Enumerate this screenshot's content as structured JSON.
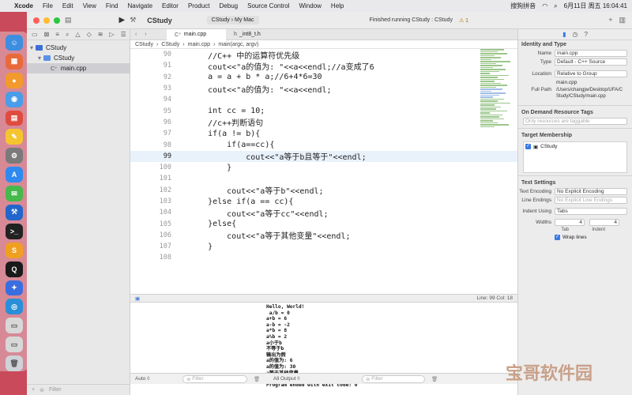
{
  "menubar": {
    "apple": "",
    "app": "Xcode",
    "items": [
      "File",
      "Edit",
      "View",
      "Find",
      "Navigate",
      "Editor",
      "Product",
      "Debug",
      "Source Control",
      "Window",
      "Help"
    ],
    "input_method": "搜狗拼音",
    "datetime": "6月11日 周五 16:04:41"
  },
  "toolbar": {
    "project": "CStudy",
    "scheme_target": "CStudy",
    "scheme_device": "My Mac",
    "status": "Finished running CStudy : CStudy",
    "warning": "⚠ 1"
  },
  "navigator": {
    "items": [
      {
        "label": "CStudy",
        "type": "project"
      },
      {
        "label": "CStudy",
        "type": "folder"
      },
      {
        "label": "main.cpp",
        "type": "file"
      }
    ],
    "filter_placeholder": "Filter"
  },
  "editor": {
    "tabs": [
      "main.cpp",
      "_int8_t.h"
    ],
    "jumpbar": [
      "CStudy",
      "CStudy",
      "main.cpp",
      "main(argc, argv)"
    ],
    "current_line": 99,
    "lines": [
      {
        "n": "90",
        "t": "    //C++ 中的运算符优先级"
      },
      {
        "n": "91",
        "t": "    cout<<\"a的值为: \"<<a<<endl;//a变成了6"
      },
      {
        "n": "92",
        "t": "    a = a + b * a;//6+4*6=30"
      },
      {
        "n": "93",
        "t": "    cout<<\"a的值为: \"<<a<<endl;"
      },
      {
        "n": "94",
        "t": ""
      },
      {
        "n": "95",
        "t": "    int cc = 10;"
      },
      {
        "n": "96",
        "t": "    //c++判断语句"
      },
      {
        "n": "97",
        "t": "    if(a != b){"
      },
      {
        "n": "98",
        "t": "        if(a==cc){"
      },
      {
        "n": "99",
        "t": "            cout<<\"a等于b且等于\"<<endl;"
      },
      {
        "n": "100",
        "t": "        }"
      },
      {
        "n": "101",
        "t": ""
      },
      {
        "n": "102",
        "t": "        cout<<\"a等于b\"<<endl;"
      },
      {
        "n": "103",
        "t": "    }else if(a == cc){"
      },
      {
        "n": "104",
        "t": "        cout<<\"a等于cc\"<<endl;"
      },
      {
        "n": "105",
        "t": "    }else{"
      },
      {
        "n": "106",
        "t": "        cout<<\"a等于其他变量\"<<endl;"
      },
      {
        "n": "107",
        "t": "    }"
      },
      {
        "n": "108",
        "t": ""
      }
    ]
  },
  "debugbar": {
    "position": "Line: 99  Col: 18"
  },
  "console": {
    "lines": [
      "Hello, World!",
      " a/b = 0",
      "a+b = 6",
      "a-b = -2",
      "a*b = 8",
      "a%b = 2",
      "a小于b",
      "不等于b",
      "输出为假",
      "a的值为: 6",
      "a的值为: 30",
      "a等于其他变量",
      "0000000",
      "Program ended with exit code: 0"
    ],
    "mode": "Auto ◊",
    "filter_placeholder": "Filter",
    "output_selector": "All Output ◊",
    "filter2_placeholder": "Filter"
  },
  "inspector": {
    "identity_title": "Identity and Type",
    "name_label": "Name",
    "name_value": "main.cpp",
    "type_label": "Type",
    "type_value": "Default - C++ Source",
    "location_label": "Location",
    "location_value": "Relative to Group",
    "location_file": "main.cpp",
    "fullpath_label": "Full Path",
    "fullpath_value": "/Users/changjw/Desktop/UFA/CStudy/CStudy/main.cpp",
    "odr_title": "On Demand Resource Tags",
    "odr_placeholder": "Only resources are taggable",
    "target_title": "Target Membership",
    "target_item": "CStudy",
    "text_title": "Text Settings",
    "encoding_label": "Text Encoding",
    "encoding_value": "No Explicit Encoding",
    "endings_label": "Line Endings",
    "endings_value": "No Explicit Line Endings",
    "indent_label": "Indent Using",
    "indent_value": "Tabs",
    "widths_label": "Widths",
    "tab_width": "4",
    "indent_width": "4",
    "tab_caption": "Tab",
    "indent_caption": "Indent",
    "wrap_label": "Wrap lines"
  },
  "watermark": "宝哥软件园",
  "colors": {
    "desktop": "#c94a5a",
    "accent": "#3a7ae4",
    "close": "#ff5f57",
    "minimize": "#febc2e",
    "zoom": "#28c840"
  }
}
